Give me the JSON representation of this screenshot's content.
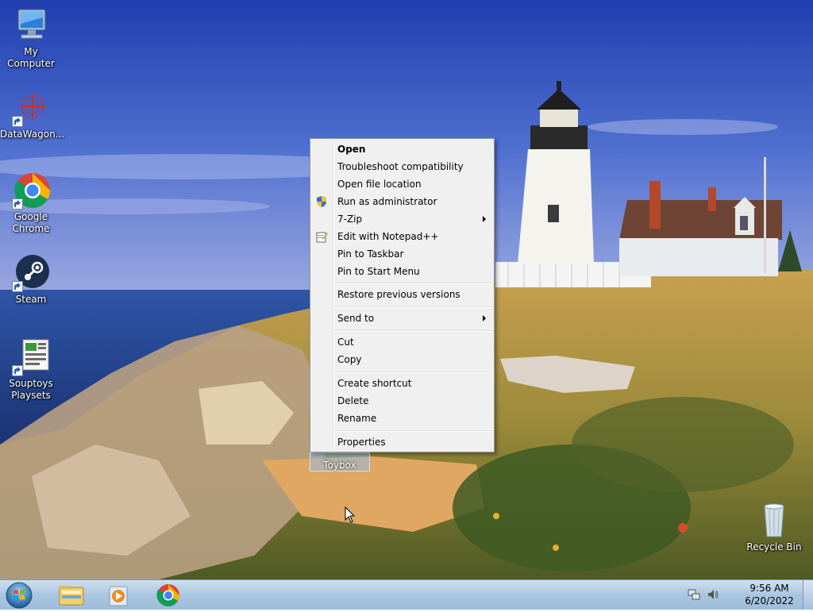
{
  "desktop": {
    "icons": [
      {
        "label": "My Computer"
      },
      {
        "label": "DataWagon..."
      },
      {
        "label": "Google Chrome"
      },
      {
        "label": "Steam"
      },
      {
        "label": "Souptoys Playsets"
      },
      {
        "label": "Recycle Bin"
      }
    ],
    "selected_icon": {
      "label": "Toybox"
    }
  },
  "context_menu": {
    "items": [
      {
        "label": "Open",
        "bold": true
      },
      {
        "label": "Troubleshoot compatibility"
      },
      {
        "label": "Open file location"
      },
      {
        "label": "Run as administrator",
        "icon": "shield-icon"
      },
      {
        "label": "7-Zip",
        "submenu": true
      },
      {
        "label": "Edit with Notepad++",
        "icon": "notepad-plus-plus-icon"
      },
      {
        "label": "Pin to Taskbar"
      },
      {
        "label": "Pin to Start Menu"
      },
      {
        "label": "Restore previous versions"
      },
      {
        "label": "Send to",
        "submenu": true
      },
      {
        "label": "Cut"
      },
      {
        "label": "Copy"
      },
      {
        "label": "Create shortcut"
      },
      {
        "label": "Delete"
      },
      {
        "label": "Rename"
      },
      {
        "label": "Properties"
      }
    ]
  },
  "taskbar": {
    "pinned": [
      {
        "icon": "file-explorer-icon"
      },
      {
        "icon": "media-player-icon"
      },
      {
        "icon": "chrome-icon"
      }
    ],
    "tray": {
      "time": "9:56 AM",
      "date": "6/20/2022"
    }
  },
  "colors": {
    "taskbar": "#a9c6e0",
    "menu_bg": "#f0f0f0",
    "sky_top": "#2b4fb8",
    "sea": "#1e3f8f"
  }
}
